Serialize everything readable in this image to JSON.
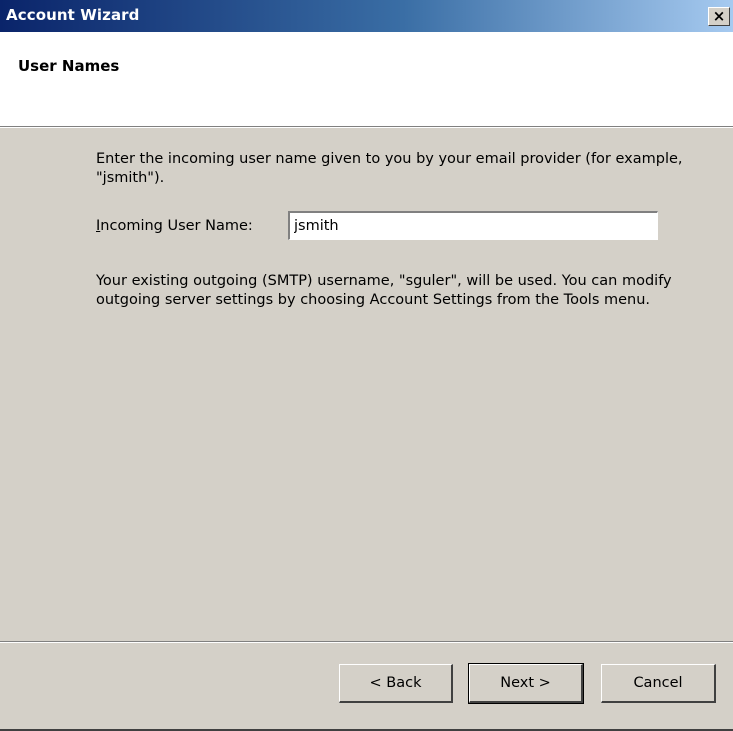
{
  "window": {
    "title": "Account Wizard",
    "close_label": "×"
  },
  "header": {
    "title": "User Names"
  },
  "content": {
    "intro": "Enter the incoming user name given to you by your email provider (for example, \"jsmith\").",
    "field_label_access_key": "I",
    "field_label_rest": "ncoming User Name:",
    "field_value": "jsmith",
    "info": "Your existing outgoing (SMTP) username, \"sguler\", will be used. You can modify outgoing server settings by choosing Account Settings from the Tools menu."
  },
  "footer": {
    "back_label": "< Back",
    "next_label": "Next >",
    "cancel_label": "Cancel"
  },
  "colors": {
    "title_bar_start": "#0a246a",
    "title_bar_end": "#a6caf0",
    "dialog_face": "#d4d0c8"
  }
}
